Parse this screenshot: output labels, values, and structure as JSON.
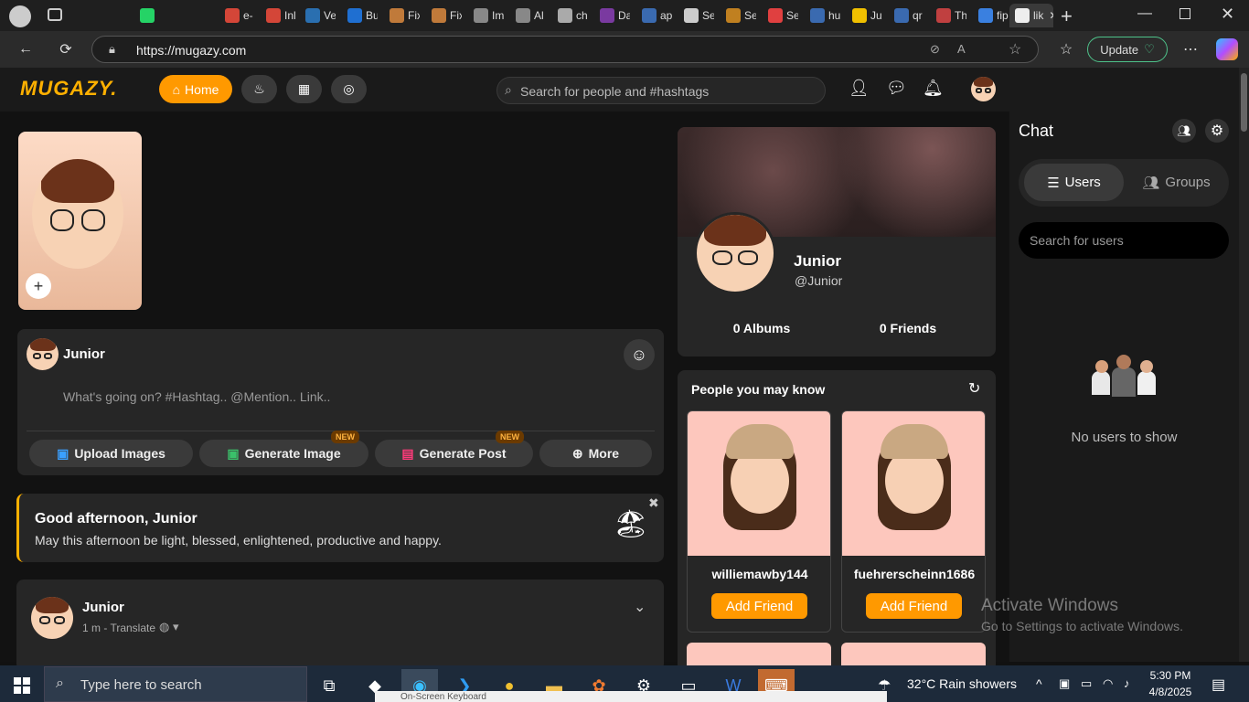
{
  "browser": {
    "tabs": [
      "",
      "e-",
      "Inl",
      "Ve",
      "Bu",
      "Fix",
      "Fix",
      "Im",
      "Al",
      "ch",
      "Da",
      "ap",
      "Se",
      "Se",
      "Se",
      "hu",
      "Ju",
      "qr",
      "Th",
      "fip",
      "lik"
    ],
    "url": "https://mugazy.com",
    "update_label": "Update"
  },
  "app": {
    "logo": "MUGAZY.",
    "home_label": "Home",
    "search_placeholder": "Search for people and #hashtags"
  },
  "composer": {
    "user": "Junior",
    "placeholder": "What's going on? #Hashtag.. @Mention.. Link..",
    "actions": [
      {
        "label": "Upload Images",
        "badge": ""
      },
      {
        "label": "Generate Image",
        "badge": "NEW"
      },
      {
        "label": "Generate Post",
        "badge": "NEW"
      },
      {
        "label": "More",
        "badge": ""
      }
    ]
  },
  "greeting": {
    "title": "Good afternoon, Junior",
    "message": "May this afternoon be light, blessed, enlightened, productive and happy."
  },
  "post": {
    "user": "Junior",
    "meta": "1 m - Translate"
  },
  "profile": {
    "name": "Junior",
    "handle": "@Junior",
    "albums": "0 Albums",
    "friends": "0 Friends"
  },
  "people": {
    "title": "People you may know",
    "items": [
      {
        "name": "williemawby144",
        "button": "Add Friend"
      },
      {
        "name": "fuehrerscheinn1686",
        "button": "Add Friend"
      }
    ]
  },
  "chat": {
    "title": "Chat",
    "tab_users": "Users",
    "tab_groups": "Groups",
    "search_placeholder": "Search for users",
    "empty": "No users to show"
  },
  "watermark": {
    "line1": "Activate Windows",
    "line2": "Go to Settings to activate Windows."
  },
  "taskbar": {
    "search_placeholder": "Type here to search",
    "weather": "32°C  Rain showers",
    "time": "5:30 PM",
    "date": "4/8/2025",
    "keyboard_label": "On-Screen Keyboard"
  },
  "colors": {
    "accent": "#ff9900",
    "background": "#121212",
    "card": "#262626"
  }
}
